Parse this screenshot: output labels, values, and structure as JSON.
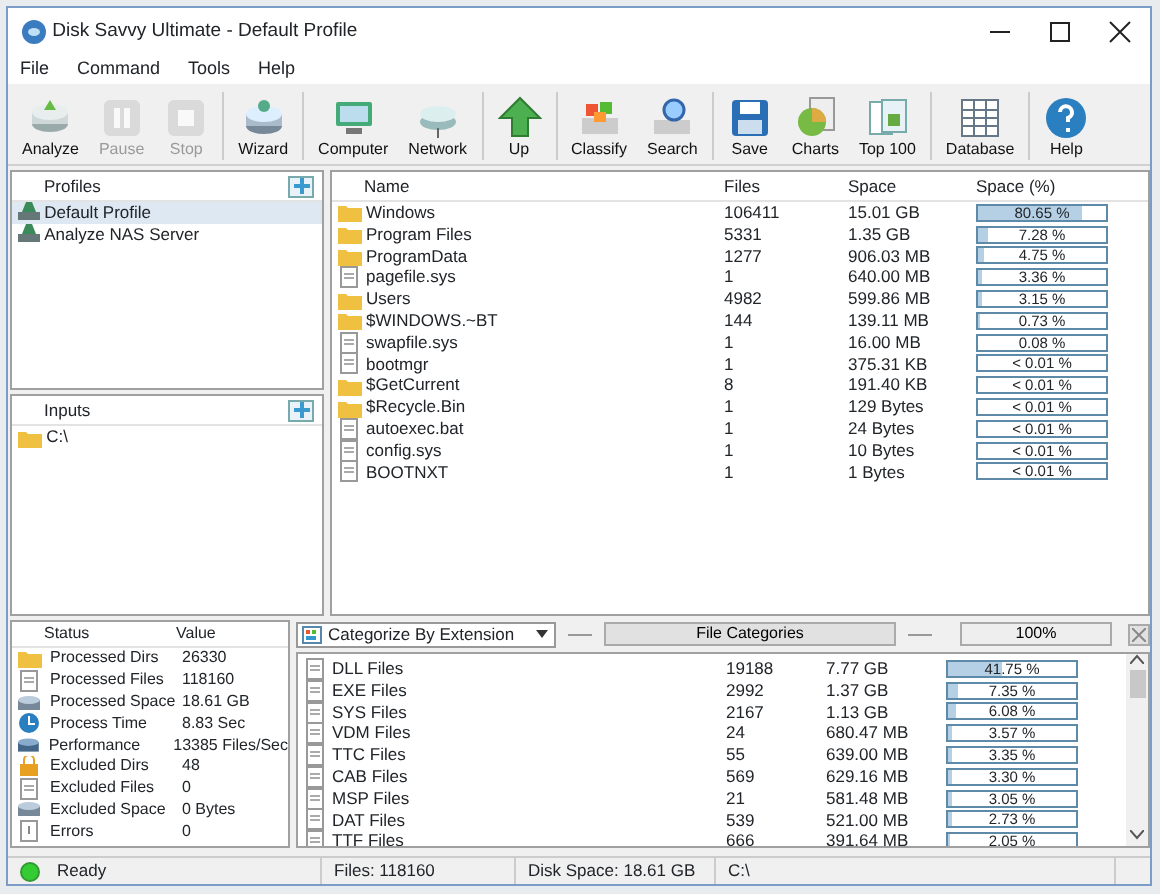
{
  "window": {
    "title": "Disk Savvy Ultimate - Default Profile"
  },
  "menu": [
    "File",
    "Command",
    "Tools",
    "Help"
  ],
  "toolbar": [
    {
      "label": "Analyze",
      "disabled": false
    },
    {
      "label": "Pause",
      "disabled": true
    },
    {
      "label": "Stop",
      "disabled": true
    },
    {
      "label": "Wizard",
      "disabled": false
    },
    {
      "label": "Computer",
      "disabled": false
    },
    {
      "label": "Network",
      "disabled": false
    },
    {
      "label": "Up",
      "disabled": false
    },
    {
      "label": "Classify",
      "disabled": false
    },
    {
      "label": "Search",
      "disabled": false
    },
    {
      "label": "Save",
      "disabled": false
    },
    {
      "label": "Charts",
      "disabled": false
    },
    {
      "label": "Top 100",
      "disabled": false
    },
    {
      "label": "Database",
      "disabled": false
    },
    {
      "label": "Help",
      "disabled": false
    }
  ],
  "profiles": {
    "title": "Profiles",
    "items": [
      {
        "label": "Default Profile",
        "selected": true
      },
      {
        "label": "Analyze NAS Server",
        "selected": false
      }
    ]
  },
  "inputs": {
    "title": "Inputs",
    "items": [
      {
        "label": "C:\\"
      }
    ]
  },
  "files": {
    "columns": [
      "Name",
      "Files",
      "Space",
      "Space (%)"
    ],
    "rows": [
      {
        "kind": "folder",
        "name": "Windows",
        "files": "106411",
        "space": "15.01 GB",
        "percent": "80.65 %",
        "level": 0.8065
      },
      {
        "kind": "folder",
        "name": "Program Files",
        "files": "5331",
        "space": "1.35 GB",
        "percent": "7.28 %",
        "level": 0.0728
      },
      {
        "kind": "folder",
        "name": "ProgramData",
        "files": "1277",
        "space": "906.03 MB",
        "percent": "4.75 %",
        "level": 0.0475
      },
      {
        "kind": "file",
        "name": "pagefile.sys",
        "files": "1",
        "space": "640.00 MB",
        "percent": "3.36 %",
        "level": 0.0336
      },
      {
        "kind": "folder",
        "name": "Users",
        "files": "4982",
        "space": "599.86 MB",
        "percent": "3.15 %",
        "level": 0.0315
      },
      {
        "kind": "folder",
        "name": "$WINDOWS.~BT",
        "files": "144",
        "space": "139.11 MB",
        "percent": "0.73 %",
        "level": 0.0073
      },
      {
        "kind": "file",
        "name": "swapfile.sys",
        "files": "1",
        "space": "16.00 MB",
        "percent": "0.08 %",
        "level": 0.0008
      },
      {
        "kind": "file",
        "name": "bootmgr",
        "files": "1",
        "space": "375.31 KB",
        "percent": "< 0.01 %",
        "level": 0
      },
      {
        "kind": "folder",
        "name": "$GetCurrent",
        "files": "8",
        "space": "191.40 KB",
        "percent": "< 0.01 %",
        "level": 0
      },
      {
        "kind": "folder",
        "name": "$Recycle.Bin",
        "files": "1",
        "space": "129 Bytes",
        "percent": "< 0.01 %",
        "level": 0
      },
      {
        "kind": "file",
        "name": "autoexec.bat",
        "files": "1",
        "space": "24 Bytes",
        "percent": "< 0.01 %",
        "level": 0
      },
      {
        "kind": "file",
        "name": "config.sys",
        "files": "1",
        "space": "10 Bytes",
        "percent": "< 0.01 %",
        "level": 0
      },
      {
        "kind": "file",
        "name": "BOOTNXT",
        "files": "1",
        "space": "1 Bytes",
        "percent": "< 0.01 %",
        "level": 0
      }
    ]
  },
  "status": {
    "columns": [
      "Status",
      "Value"
    ],
    "rows": [
      {
        "label": "Processed Dirs",
        "value": "26330"
      },
      {
        "label": "Processed Files",
        "value": "118160"
      },
      {
        "label": "Processed Space",
        "value": "18.61 GB"
      },
      {
        "label": "Process Time",
        "value": "8.83 Sec"
      },
      {
        "label": "Performance",
        "value": "13385 Files/Sec"
      },
      {
        "label": "Excluded Dirs",
        "value": "48"
      },
      {
        "label": "Excluded Files",
        "value": "0"
      },
      {
        "label": "Excluded Space",
        "value": "0 Bytes"
      },
      {
        "label": "Errors",
        "value": "0"
      }
    ]
  },
  "categories": {
    "mode": "Categorize By Extension",
    "title": "File Categories",
    "zoom": "100%",
    "rows": [
      {
        "name": "DLL Files",
        "files": "19188",
        "space": "7.77 GB",
        "percent": "41.75 %",
        "level": 0.4175
      },
      {
        "name": "EXE Files",
        "files": "2992",
        "space": "1.37 GB",
        "percent": "7.35 %",
        "level": 0.0735
      },
      {
        "name": "SYS Files",
        "files": "2167",
        "space": "1.13 GB",
        "percent": "6.08 %",
        "level": 0.0608
      },
      {
        "name": "VDM Files",
        "files": "24",
        "space": "680.47 MB",
        "percent": "3.57 %",
        "level": 0.0357
      },
      {
        "name": "TTC Files",
        "files": "55",
        "space": "639.00 MB",
        "percent": "3.35 %",
        "level": 0.0335
      },
      {
        "name": "CAB Files",
        "files": "569",
        "space": "629.16 MB",
        "percent": "3.30 %",
        "level": 0.033
      },
      {
        "name": "MSP Files",
        "files": "21",
        "space": "581.48 MB",
        "percent": "3.05 %",
        "level": 0.0305
      },
      {
        "name": "DAT Files",
        "files": "539",
        "space": "521.00 MB",
        "percent": "2.73 %",
        "level": 0.0273
      },
      {
        "name": "TTF Files",
        "files": "666",
        "space": "391.64 MB",
        "percent": "2.05 %",
        "level": 0.0205
      }
    ]
  },
  "status_bar": [
    "Ready",
    "Files: 118160",
    "Disk Space: 18.61 GB",
    "C:\\"
  ]
}
